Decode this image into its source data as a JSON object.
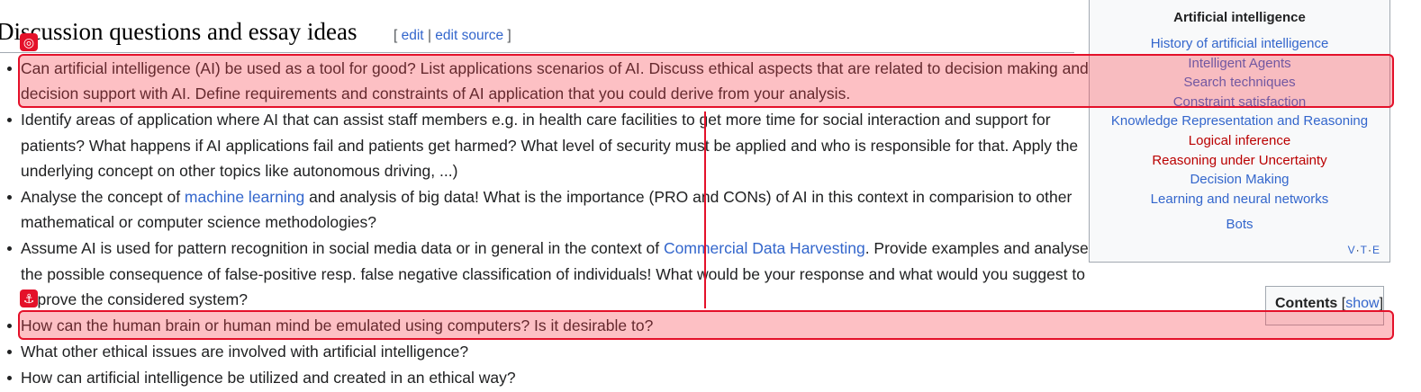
{
  "section": {
    "title": "Discussion questions and essay ideas",
    "edit_open": "[",
    "edit_label": "edit",
    "edit_sep": "|",
    "edit_source_label": "edit source",
    "edit_close": "]"
  },
  "questions": [
    {
      "text": "Can artificial intelligence (AI) be used as a tool for good? List applications scenarios of AI. Discuss ethical aspects that are related to decision making and decision support with AI. Define requirements and constraints of AI application that you could derive from your analysis."
    },
    {
      "text": "Identify areas of application where AI that can assist staff members e.g. in health care facilities to get more time for social interaction and support for patients? What happens if AI applications fail and patients get harmed? What level of security must be applied and who is responsible for that. Apply the underlying concept on other topics like autonomous driving, ...)"
    },
    {
      "before": "Analyse the concept of ",
      "link": "machine learning",
      "after": " and analysis of big data! What is the importance (PRO and CONs) of AI in this context in comparision to other mathematical or computer science methodologies?"
    },
    {
      "before": "Assume AI is used for pattern recognition in social media data or in general in the context of ",
      "link": "Commercial Data Harvesting",
      "after": ". Provide examples and analyse the possible consequence of false-positive resp. false negative classification of individuals! What would be your response and what would you suggest to improve the considered system?"
    },
    {
      "text": "How can the human brain or human mind be emulated using computers? Is it desirable to?"
    },
    {
      "text": "What other ethical issues are involved with artificial intelligence?"
    },
    {
      "text": "How can artificial intelligence be utilized and created in an ethical way?"
    }
  ],
  "navbox": {
    "title": "Artificial intelligence",
    "links": [
      {
        "label": "History of artificial intelligence",
        "color": "#3366cc"
      },
      {
        "label": "Intelligent Agents",
        "color": "#3366cc"
      },
      {
        "label": "Search techniques",
        "color": "#3366cc"
      },
      {
        "label": "Constraint satisfaction",
        "color": "#3366cc"
      },
      {
        "label": "Knowledge Representation and Reasoning",
        "color": "#3366cc"
      },
      {
        "label": "Logical inference",
        "color": "#ba0000"
      },
      {
        "label": "Reasoning under Uncertainty",
        "color": "#ba0000"
      },
      {
        "label": "Decision Making",
        "color": "#3366cc"
      },
      {
        "label": "Learning and neural networks",
        "color": "#3366cc"
      }
    ],
    "bots": "Bots",
    "vte": {
      "v": "V",
      "t": "T",
      "e": "E"
    }
  },
  "contents": {
    "label": "Contents",
    "open": "[",
    "toggle": "show",
    "close": "]"
  },
  "overlay": {
    "target_icon": "target-icon",
    "anchor_icon": "anchor-icon",
    "color": "#e4112a"
  }
}
